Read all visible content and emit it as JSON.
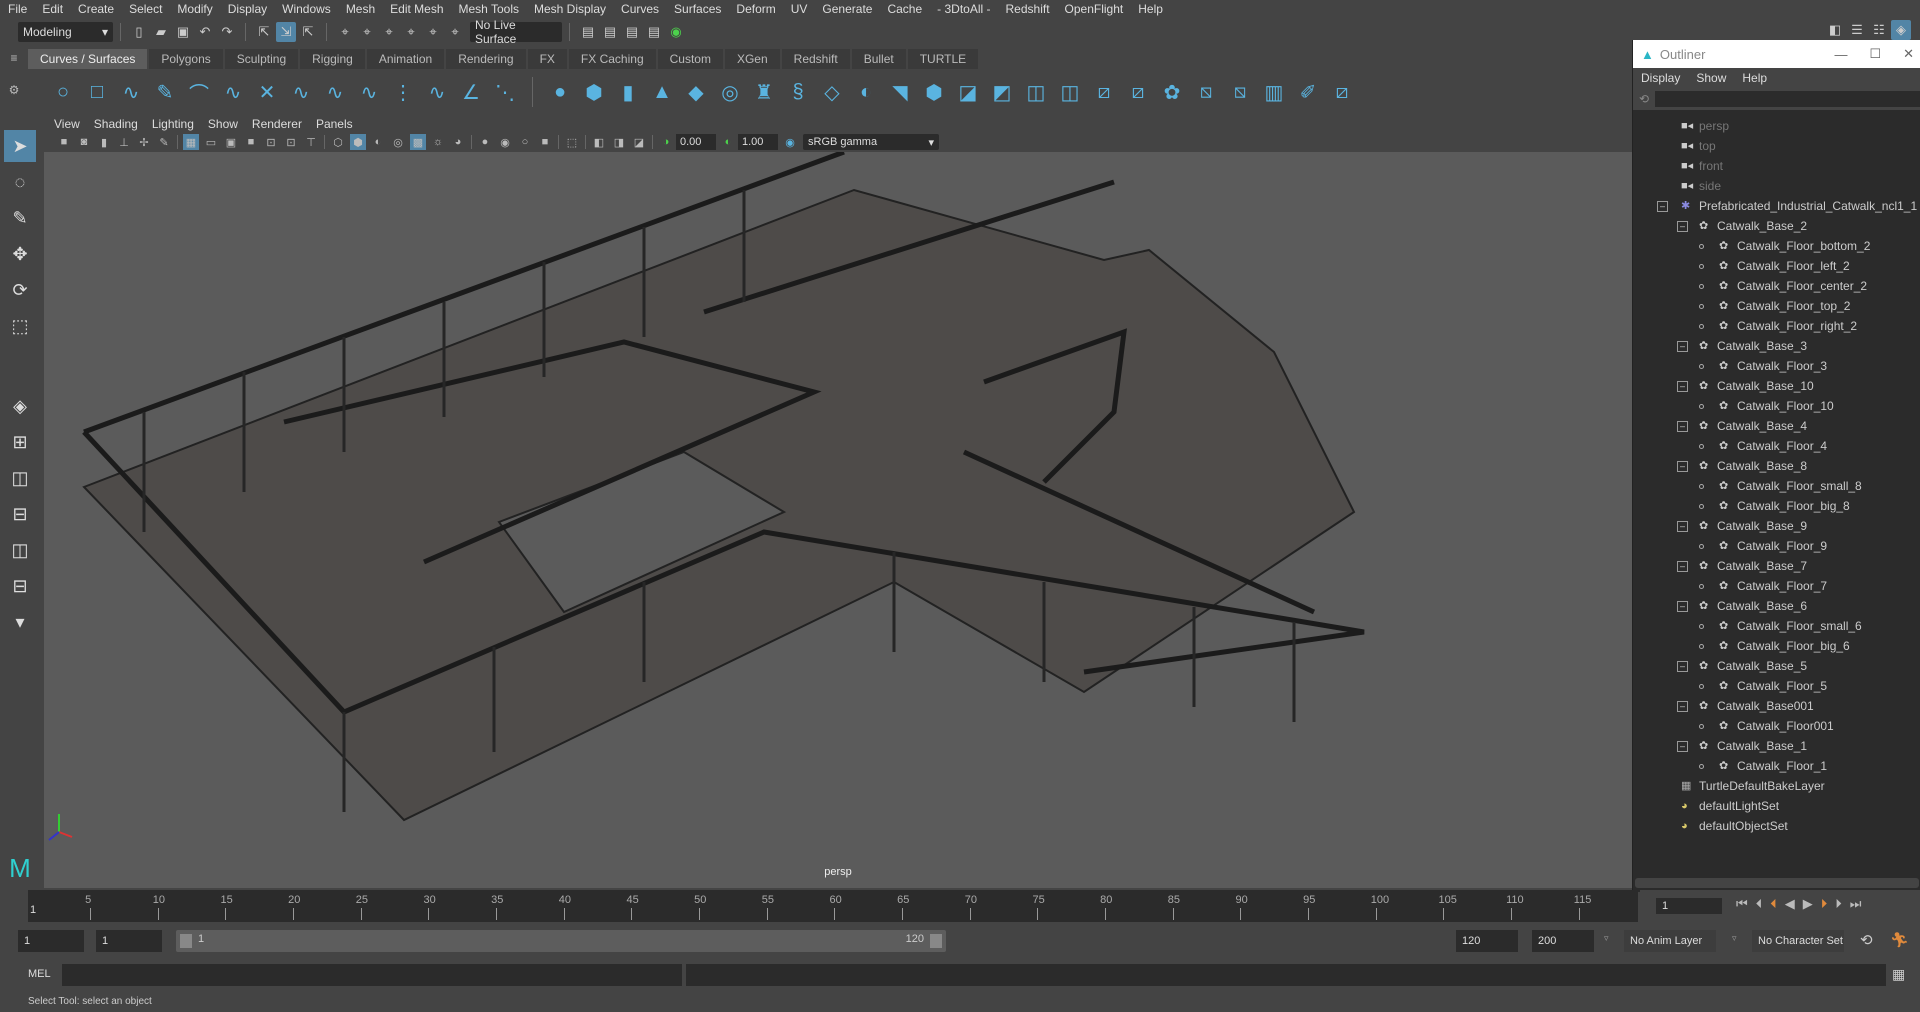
{
  "menubar": [
    "File",
    "Edit",
    "Create",
    "Select",
    "Modify",
    "Display",
    "Windows",
    "Mesh",
    "Edit Mesh",
    "Mesh Tools",
    "Mesh Display",
    "Curves",
    "Surfaces",
    "Deform",
    "UV",
    "Generate",
    "Cache",
    "- 3DtoAll -",
    "Redshift",
    "OpenFlight",
    "Help"
  ],
  "status": {
    "workspace": "Modeling",
    "live_surface": "No Live Surface"
  },
  "shelf_tabs": [
    "Curves / Surfaces",
    "Polygons",
    "Sculpting",
    "Rigging",
    "Animation",
    "Rendering",
    "FX",
    "FX Caching",
    "Custom",
    "XGen",
    "Redshift",
    "Bullet",
    "TURTLE"
  ],
  "active_shelf_tab": "Curves / Surfaces",
  "viewport": {
    "menu": [
      "View",
      "Shading",
      "Lighting",
      "Show",
      "Renderer",
      "Panels"
    ],
    "exposure": "0.00",
    "gamma": "1.00",
    "color_space": "sRGB gamma",
    "camera": "persp"
  },
  "outliner": {
    "title": "Outliner",
    "menu": [
      "Display",
      "Show",
      "Help"
    ],
    "cameras": [
      "persp",
      "top",
      "front",
      "side"
    ],
    "root": "Prefabricated_Industrial_Catwalk_ncl1_1",
    "groups": [
      {
        "name": "Catwalk_Base_2",
        "children": [
          "Catwalk_Floor_bottom_2",
          "Catwalk_Floor_left_2",
          "Catwalk_Floor_center_2",
          "Catwalk_Floor_top_2",
          "Catwalk_Floor_right_2"
        ]
      },
      {
        "name": "Catwalk_Base_3",
        "children": [
          "Catwalk_Floor_3"
        ]
      },
      {
        "name": "Catwalk_Base_10",
        "children": [
          "Catwalk_Floor_10"
        ]
      },
      {
        "name": "Catwalk_Base_4",
        "children": [
          "Catwalk_Floor_4"
        ]
      },
      {
        "name": "Catwalk_Base_8",
        "children": [
          "Catwalk_Floor_small_8",
          "Catwalk_Floor_big_8"
        ]
      },
      {
        "name": "Catwalk_Base_9",
        "children": [
          "Catwalk_Floor_9"
        ]
      },
      {
        "name": "Catwalk_Base_7",
        "children": [
          "Catwalk_Floor_7"
        ]
      },
      {
        "name": "Catwalk_Base_6",
        "children": [
          "Catwalk_Floor_small_6",
          "Catwalk_Floor_big_6"
        ]
      },
      {
        "name": "Catwalk_Base_5",
        "children": [
          "Catwalk_Floor_5"
        ]
      },
      {
        "name": "Catwalk_Base001",
        "children": [
          "Catwalk_Floor001"
        ]
      },
      {
        "name": "Catwalk_Base_1",
        "children": [
          "Catwalk_Floor_1"
        ]
      }
    ],
    "extras": [
      {
        "name": "TurtleDefaultBakeLayer",
        "icon": "bake-layer-icon"
      },
      {
        "name": "defaultLightSet",
        "icon": "set-icon"
      },
      {
        "name": "defaultObjectSet",
        "icon": "set-icon"
      }
    ]
  },
  "timeline": {
    "ticks": [
      "5",
      "10",
      "15",
      "20",
      "25",
      "30",
      "35",
      "40",
      "45",
      "50",
      "55",
      "60",
      "65",
      "70",
      "75",
      "80",
      "85",
      "90",
      "95",
      "100",
      "105",
      "110",
      "115"
    ],
    "current_frame": "1",
    "current_frame_field": "1"
  },
  "range": {
    "start": "1",
    "playback_start": "1",
    "slider_start": "1",
    "slider_end": "120",
    "playback_end": "120",
    "end": "200",
    "anim_layer": "No Anim Layer",
    "character_set": "No Character Set"
  },
  "cmdline": {
    "label": "MEL"
  },
  "helpline": "Select Tool: select an object"
}
